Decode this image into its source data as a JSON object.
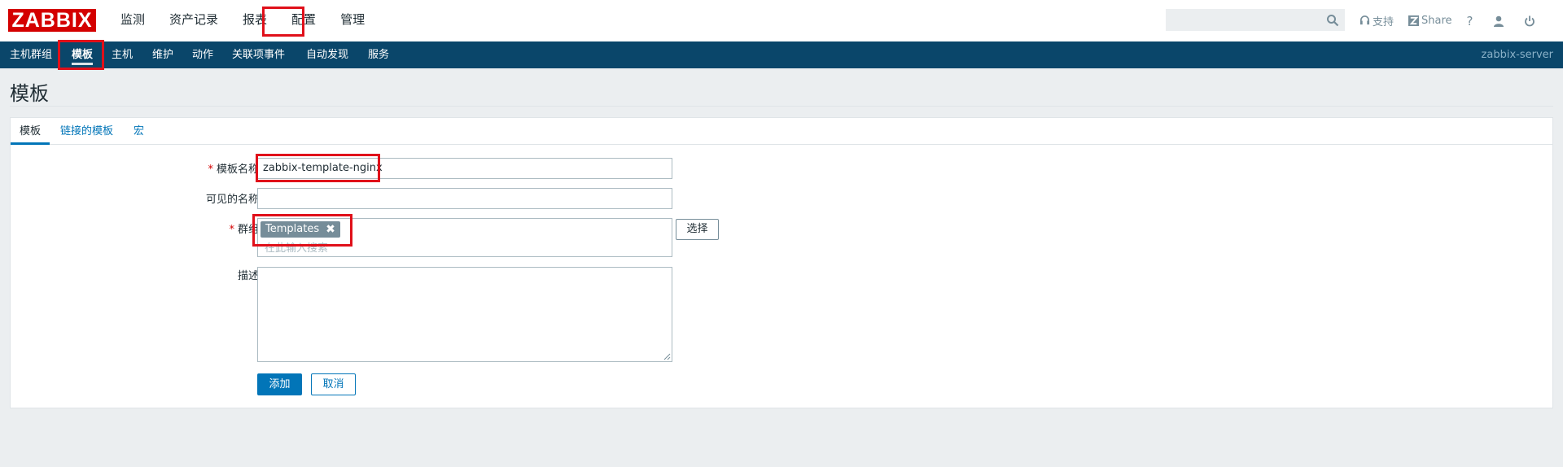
{
  "header": {
    "logo": "ZABBIX",
    "menu": [
      "监测",
      "资产记录",
      "报表",
      "配置",
      "管理"
    ],
    "active_menu": "配置",
    "tools": {
      "support": "支持",
      "share": "Share",
      "help": "?"
    }
  },
  "subnav": {
    "items": [
      "主机群组",
      "模板",
      "主机",
      "维护",
      "动作",
      "关联项事件",
      "自动发现",
      "服务"
    ],
    "active": "模板",
    "server": "zabbix-server"
  },
  "page": {
    "title": "模板"
  },
  "tabs": [
    "模板",
    "链接的模板",
    "宏"
  ],
  "form": {
    "template_name_label": "模板名称",
    "template_name_value": "zabbix-template-nginx",
    "visible_name_label": "可见的名称",
    "visible_name_value": "",
    "groups_label": "群组",
    "group_tag": "Templates",
    "groups_placeholder": "在此输入搜索",
    "select_button": "选择",
    "description_label": "描述",
    "description_value": "",
    "add_button": "添加",
    "cancel_button": "取消"
  },
  "colors": {
    "brand_red": "#d40000",
    "nav_blue": "#0a466a",
    "accent_blue": "#0275b8",
    "highlight_red": "#e0101a"
  },
  "icons": [
    "search-icon",
    "headset-icon",
    "share-icon",
    "help-icon",
    "user-icon",
    "power-icon",
    "remove-icon",
    "resize-handle-icon"
  ]
}
